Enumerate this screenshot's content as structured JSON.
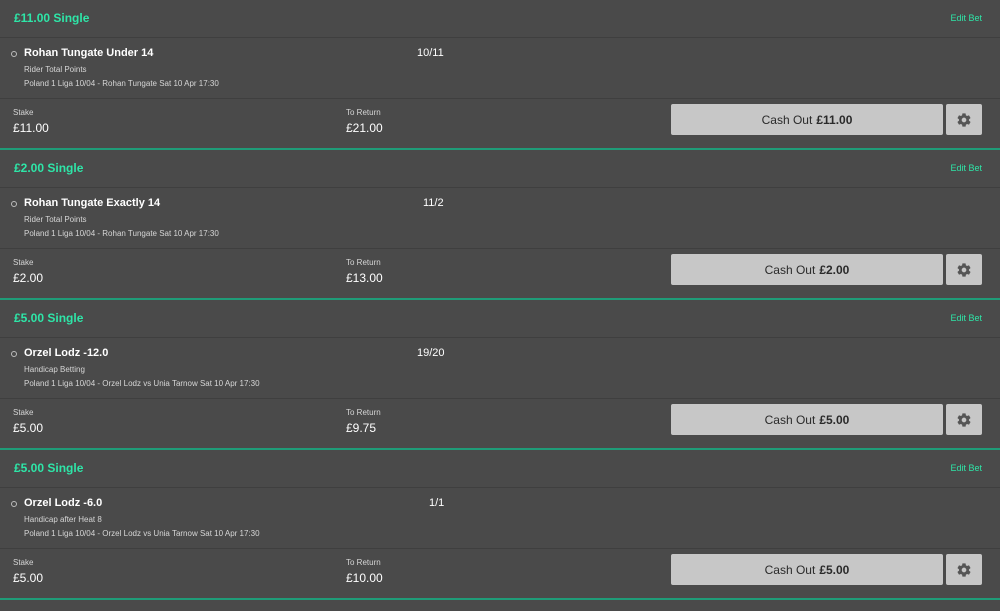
{
  "bets": [
    {
      "title": "£11.00 Single",
      "edit_label": "Edit Bet",
      "selection": "Rohan Tungate Under 14",
      "market": "Rider Total Points",
      "event": "Poland 1 Liga 10/04 - Rohan Tungate   Sat 10 Apr 17:30",
      "odds": "10/11",
      "stake_label": "Stake",
      "stake": "£11.00",
      "return_label": "To Return",
      "to_return": "£21.00",
      "cashout_label": "Cash Out",
      "cashout_amount": "£11.00"
    },
    {
      "title": "£2.00 Single",
      "edit_label": "Edit Bet",
      "selection": "Rohan Tungate Exactly 14",
      "market": "Rider Total Points",
      "event": "Poland 1 Liga 10/04 - Rohan Tungate   Sat 10 Apr 17:30",
      "odds": "11/2",
      "stake_label": "Stake",
      "stake": "£2.00",
      "return_label": "To Return",
      "to_return": "£13.00",
      "cashout_label": "Cash Out",
      "cashout_amount": "£2.00"
    },
    {
      "title": "£5.00 Single",
      "edit_label": "Edit Bet",
      "selection": "Orzel Lodz -12.0",
      "market": "Handicap Betting",
      "event": "Poland 1 Liga 10/04 - Orzel Lodz vs Unia Tarnow   Sat 10 Apr 17:30",
      "odds": "19/20",
      "stake_label": "Stake",
      "stake": "£5.00",
      "return_label": "To Return",
      "to_return": "£9.75",
      "cashout_label": "Cash Out",
      "cashout_amount": "£5.00"
    },
    {
      "title": "£5.00 Single",
      "edit_label": "Edit Bet",
      "selection": "Orzel Lodz -6.0",
      "market": "Handicap after Heat 8",
      "event": "Poland 1 Liga 10/04 - Orzel Lodz vs Unia Tarnow   Sat 10 Apr 17:30",
      "odds": "1/1",
      "stake_label": "Stake",
      "stake": "£5.00",
      "return_label": "To Return",
      "to_return": "£10.00",
      "cashout_label": "Cash Out",
      "cashout_amount": "£5.00"
    }
  ],
  "colors": {
    "accent": "#2ee6a8",
    "divider": "#1f9c78",
    "background": "#4a4a4a",
    "button": "#c7c7c7"
  },
  "icons": {
    "settings": "gear-icon",
    "selection_marker": "radio-dot-icon"
  }
}
